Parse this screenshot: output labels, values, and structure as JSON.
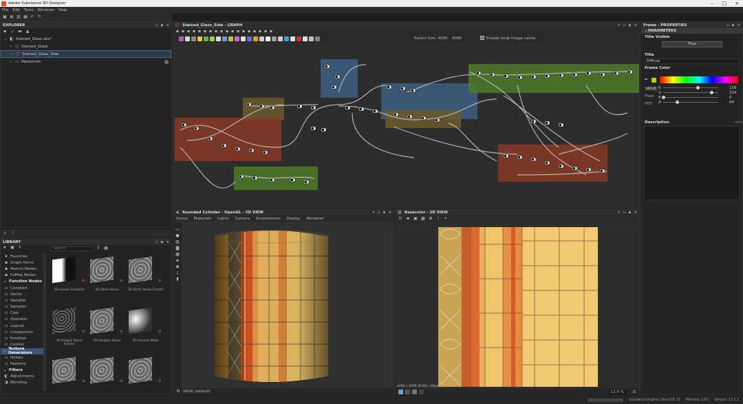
{
  "app": {
    "title": "Adobe Substance 3D Designer"
  },
  "menu": [
    "File",
    "Edit",
    "Tools",
    "Windows",
    "Help"
  ],
  "explorer": {
    "title": "EXPLORER",
    "items": [
      {
        "label": "Stained_Glass.sbs*",
        "indent": 0,
        "icon": "package-icon"
      },
      {
        "label": "Stained_Glass",
        "indent": 1,
        "icon": "graph-icon"
      },
      {
        "label": "Stained_Glass_Side",
        "indent": 1,
        "icon": "graph-icon",
        "selected": true
      },
      {
        "label": "Resources",
        "indent": 1,
        "icon": "folder-icon"
      }
    ]
  },
  "library": {
    "title": "LIBRARY",
    "search_placeholder": "Search",
    "items": [
      {
        "label": "Favorites",
        "type": "item"
      },
      {
        "label": "Graph Items",
        "type": "item"
      },
      {
        "label": "Atomic Nodes",
        "type": "item"
      },
      {
        "label": "FxMap Nodes",
        "type": "item"
      },
      {
        "label": "Function Nodes",
        "type": "hdr"
      },
      {
        "label": "Constant",
        "type": "item"
      },
      {
        "label": "Vector",
        "type": "item"
      },
      {
        "label": "Variable",
        "type": "item"
      },
      {
        "label": "Sampler",
        "type": "item"
      },
      {
        "label": "Cast",
        "type": "item"
      },
      {
        "label": "Operator",
        "type": "item"
      },
      {
        "label": "Logical",
        "type": "item"
      },
      {
        "label": "Comparison",
        "type": "item"
      },
      {
        "label": "Function",
        "type": "item"
      },
      {
        "label": "Control",
        "type": "item"
      },
      {
        "label": "Texture Generators",
        "type": "hdr",
        "selected": true
      },
      {
        "label": "Noises",
        "type": "item"
      },
      {
        "label": "Patterns",
        "type": "item"
      },
      {
        "label": "Filters",
        "type": "hdr"
      },
      {
        "label": "Adjustments",
        "type": "item"
      },
      {
        "label": "Blending",
        "type": "item"
      }
    ],
    "thumbs": [
      {
        "label": "3D Linear Gradient",
        "kind": "grad"
      },
      {
        "label": "3D Perlin Noise",
        "kind": "noise"
      },
      {
        "label": "3D Perlin Noise Fractal",
        "kind": "noise"
      },
      {
        "label": "3D Ridged Noise Fractal",
        "kind": "dark"
      },
      {
        "label": "3D Simplex Noise",
        "kind": "noise"
      },
      {
        "label": "3D Volume Mask",
        "kind": "grad2"
      },
      {
        "label": "",
        "kind": "noise"
      },
      {
        "label": "",
        "kind": "noise"
      },
      {
        "label": "",
        "kind": "noise"
      }
    ]
  },
  "graph": {
    "title": "Stained_Glass_Side - GRAPH",
    "parent_size": "Parent Size: 4096",
    "zoom": "4096",
    "cache_label": "Enable node image cache"
  },
  "view3d": {
    "title": "Rounded Cylinder - OpenGL - 3D VIEW",
    "menu": [
      "Scene",
      "Materials",
      "Lights",
      "Camera",
      "Environment",
      "Display",
      "Renderer"
    ],
    "colorspace": "sRGB (default)"
  },
  "view2d": {
    "title": "Basecolor - 2D VIEW",
    "info": "4096 x 4096 (RGBA, 16bpc)",
    "zoom": "12.5 %"
  },
  "properties": {
    "title": "Frame - PROPERTIES",
    "section": "PARAMETERS",
    "title_visible_label": "Title Visible",
    "title_visible_value": "True",
    "title_label": "Title",
    "title_value": "Diffuse",
    "frame_color_label": "Frame Color",
    "mode": "sRGB",
    "mode2": "Float",
    "mode3": "HSV",
    "channels": [
      {
        "name": "R",
        "value": "158",
        "pos": 0.62
      },
      {
        "name": "G",
        "value": "224",
        "pos": 0.87
      },
      {
        "name": "B",
        "value": "0",
        "pos": 0.0
      },
      {
        "name": "A",
        "value": "64",
        "pos": 0.25
      }
    ],
    "description_label": "Description",
    "accent": "#95c83c"
  },
  "status": {
    "engine": "Substance Engine: Direct3D 11",
    "memory": "Memory: 12%",
    "version": "Version: 13.1.1"
  }
}
